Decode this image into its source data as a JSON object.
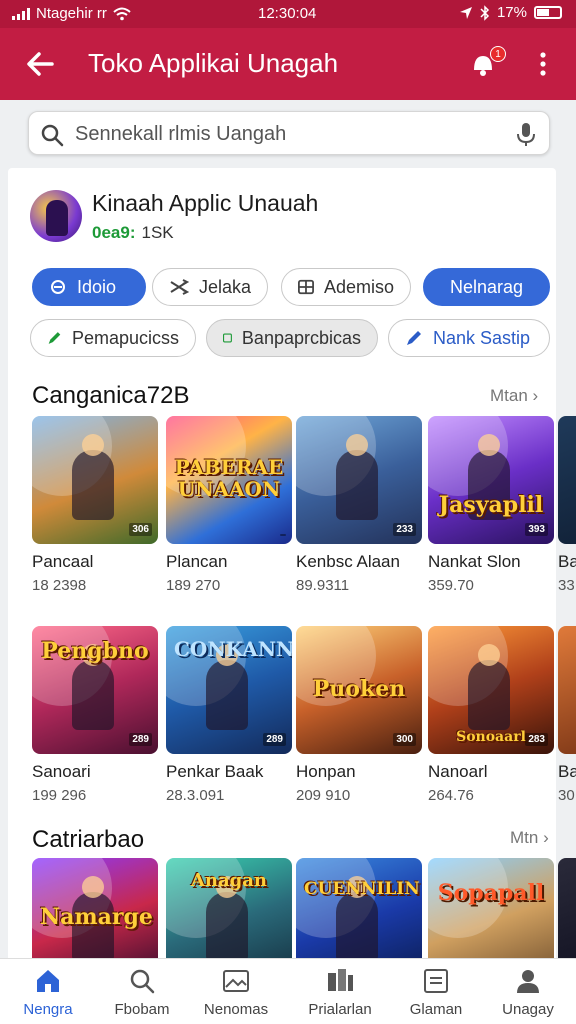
{
  "status_bar": {
    "carrier": "Ntagehir rr",
    "time": "12:30:04",
    "battery": "17%"
  },
  "app_bar": {
    "title": "Toko Applikai Unagah",
    "notification_badge": "1"
  },
  "search": {
    "text": "Sennekall rlmis Uangah"
  },
  "app": {
    "name": "Kinaah Applic Unauah",
    "rating": "0ea9:",
    "count": "1SK"
  },
  "chips_row1": [
    "Idoio",
    "Jelaka",
    "Ademiso",
    "Nelnarag"
  ],
  "chips_row2": [
    "Pemapucicss",
    "Banpaprcbicas",
    "Nank Sastip"
  ],
  "section1": {
    "title": "Canganica72B",
    "more": "Mtan",
    "row1": [
      {
        "name": "Pancaal",
        "sub": "18 2398",
        "logo": "",
        "tag": "306"
      },
      {
        "name": "Plancan",
        "sub": "189 270",
        "logo": "PABERAE UNAAON",
        "tag": ""
      },
      {
        "name": "Kenbsc Alaan",
        "sub": "89.9311",
        "logo": "",
        "tag": "233"
      },
      {
        "name": "Nankat Slon",
        "sub": "359.70",
        "logo": "Jasyaplil",
        "tag": "393"
      },
      {
        "name": "Ba",
        "sub": "33",
        "logo": "",
        "tag": ""
      }
    ],
    "row2": [
      {
        "name": "Sanoari",
        "sub": "199 296",
        "logo": "Pengbno",
        "tag": "289"
      },
      {
        "name": "Penkar Baak",
        "sub": "28.3.091",
        "logo": "CONKANN",
        "tag": "289"
      },
      {
        "name": "Honpan",
        "sub": "209 910",
        "logo": "Puoken",
        "tag": "300"
      },
      {
        "name": "Nanoarl",
        "sub": "264.76",
        "logo": "Sonoaarl",
        "tag": "283"
      },
      {
        "name": "Ba",
        "sub": "30",
        "logo": "",
        "tag": ""
      }
    ]
  },
  "section2": {
    "title": "Catriarbao",
    "more": "Mtn",
    "row": [
      {
        "logo": "Namarge"
      },
      {
        "logo": "Anagan"
      },
      {
        "logo": "CUENNILIN"
      },
      {
        "logo": "Sopapall"
      },
      {
        "logo": ""
      }
    ]
  },
  "bottom_nav": [
    "Nengra",
    "Fbobam",
    "Nenomas",
    "Prialarlan",
    "Glaman",
    "Unagay"
  ],
  "colors": {
    "brand": "#c21d43",
    "accent": "#3569d8",
    "rating": "#1d9a37"
  }
}
